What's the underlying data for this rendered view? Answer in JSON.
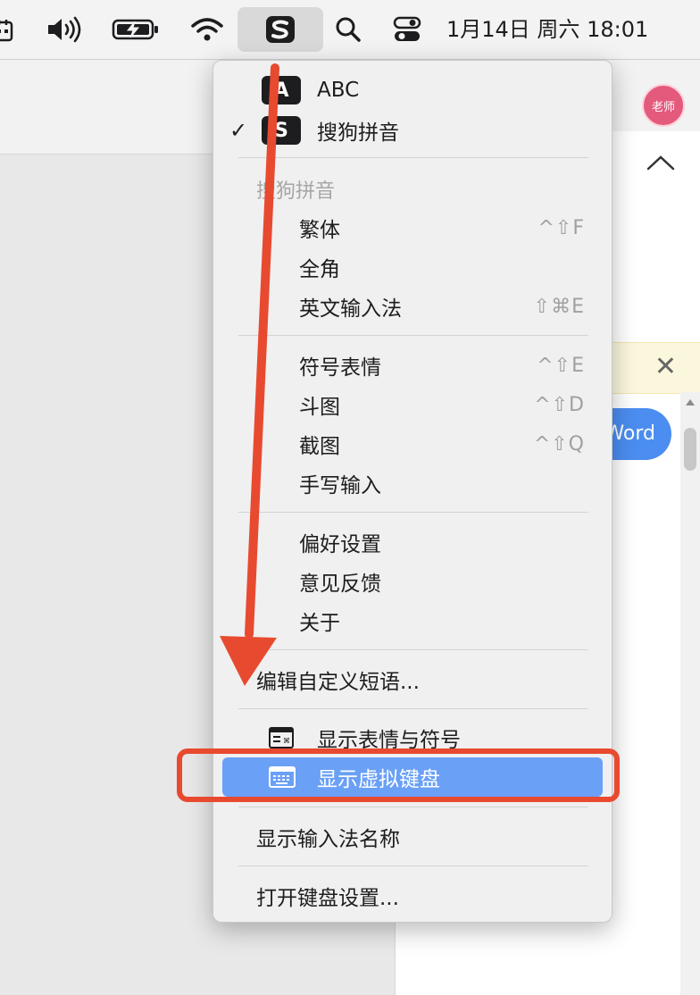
{
  "menubar": {
    "icons": [
      "calendar-icon",
      "volume-icon",
      "battery-charging-icon",
      "wifi-icon",
      "sogou-input-icon",
      "spotlight-search-icon",
      "control-center-icon"
    ],
    "clock": "1月14日 周六  18:01"
  },
  "background": {
    "avatar_text": "老师",
    "button_label": "Word"
  },
  "menu": {
    "input_sources": [
      {
        "icon_letter": "A",
        "label": "ABC",
        "checked": false
      },
      {
        "icon_letter": "S",
        "label": "搜狗拼音",
        "checked": true
      }
    ],
    "check_mark": "✓",
    "section_title": "搜狗拼音",
    "group1": [
      {
        "label": "繁体",
        "shortcut": "^⇧F"
      },
      {
        "label": "全角",
        "shortcut": ""
      },
      {
        "label": "英文输入法",
        "shortcut": "⇧⌘E"
      }
    ],
    "group2": [
      {
        "label": "符号表情",
        "shortcut": "^⇧E"
      },
      {
        "label": "斗图",
        "shortcut": "^⇧D"
      },
      {
        "label": "截图",
        "shortcut": "^⇧Q"
      },
      {
        "label": "手写输入",
        "shortcut": ""
      }
    ],
    "group3": [
      {
        "label": "偏好设置"
      },
      {
        "label": "意见反馈"
      },
      {
        "label": "关于"
      }
    ],
    "edit_phrases": "编辑自定义短语...",
    "show_emoji": "显示表情与符号",
    "show_keyboard": "显示虚拟键盘",
    "show_ime_name": "显示输入法名称",
    "open_keyboard_settings": "打开键盘设置..."
  },
  "annotation": {
    "arrow_color": "#e84a30",
    "highlight_color": "#6aa0f5"
  }
}
